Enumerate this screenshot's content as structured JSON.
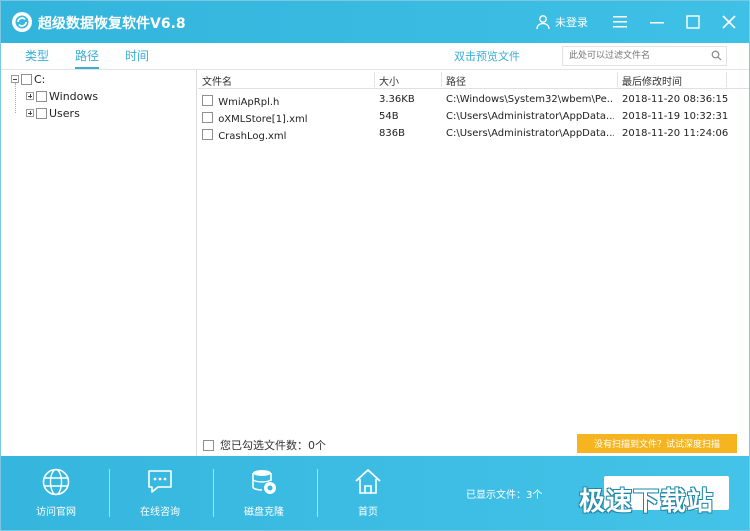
{
  "window": {
    "title": "超级数据恢复软件V6.8",
    "user_label": "未登录",
    "colors": {
      "accent": "#3aaed6",
      "titlebar": "#36b8e0",
      "scan_button": "#f6b520"
    }
  },
  "tabs": [
    {
      "label": "类型"
    },
    {
      "label": "路径"
    },
    {
      "label": "时间"
    }
  ],
  "toolbar": {
    "preview_label": "双击预览文件",
    "search_placeholder": "此处可以过滤文件名"
  },
  "tree": {
    "root": "C:",
    "children": [
      {
        "label": "Windows"
      },
      {
        "label": "Users"
      }
    ]
  },
  "table": {
    "columns": [
      "文件名",
      "大小",
      "路径",
      "最后修改时间"
    ],
    "rows": [
      {
        "name": "WmiApRpl.h",
        "size": "3.36KB",
        "path": "C:\\Windows\\System32\\wbem\\Pe...",
        "modified": "2018-11-20 08:36:15"
      },
      {
        "name": "oXMLStore[1].xml",
        "size": "54B",
        "path": "C:\\Users\\Administrator\\AppData...",
        "modified": "2018-11-19 10:32:31"
      },
      {
        "name": "CrashLog.xml",
        "size": "836B",
        "path": "C:\\Users\\Administrator\\AppData...",
        "modified": "2018-11-20 11:24:06"
      }
    ]
  },
  "footer": {
    "selected_count": "您已勾选文件数：0个",
    "deep_scan": "没有扫描到文件？试试深度扫描"
  },
  "bottom_nav": [
    {
      "label": "访问官网",
      "icon": "globe-icon"
    },
    {
      "label": "在线咨询",
      "icon": "chat-icon"
    },
    {
      "label": "磁盘克隆",
      "icon": "disk-clone-icon"
    },
    {
      "label": "首页",
      "icon": "home-icon"
    }
  ],
  "status": {
    "shown_files": "已显示文件：3个"
  },
  "watermark": "极速下载站"
}
